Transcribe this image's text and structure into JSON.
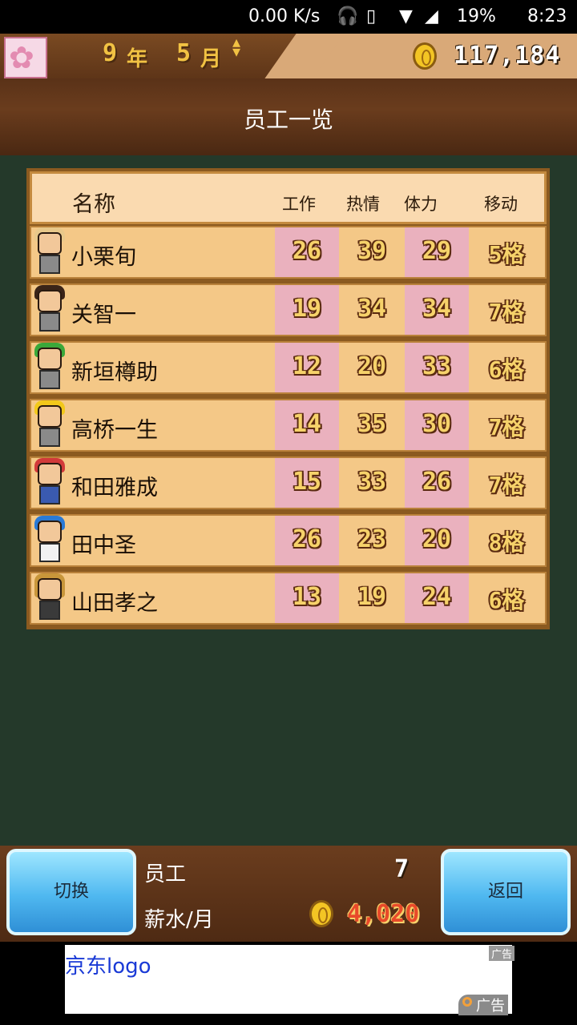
{
  "status_bar": {
    "net_speed": "0.00 K/s",
    "battery": "19%",
    "time": "8:23",
    "icons": [
      "headphones-icon",
      "vibrate-icon",
      "wifi-icon",
      "signal-icon",
      "battery-icon"
    ]
  },
  "top_bar": {
    "year_num": "9",
    "year_label": "年",
    "month_num": "5",
    "month_label": "月",
    "money": "117,184"
  },
  "title": "员工一览",
  "table": {
    "headers": {
      "name": "名称",
      "work": "工作",
      "passion": "热情",
      "stamina": "体力",
      "move": "移动"
    },
    "rows": [
      {
        "name": "小栗旬",
        "work": "26",
        "passion": "39",
        "stamina": "29",
        "move": "5格"
      },
      {
        "name": "关智一",
        "work": "19",
        "passion": "34",
        "stamina": "34",
        "move": "7格"
      },
      {
        "name": "新垣樽助",
        "work": "12",
        "passion": "20",
        "stamina": "33",
        "move": "6格"
      },
      {
        "name": "高桥一生",
        "work": "14",
        "passion": "35",
        "stamina": "30",
        "move": "7格"
      },
      {
        "name": "和田雅成",
        "work": "15",
        "passion": "33",
        "stamina": "26",
        "move": "7格"
      },
      {
        "name": "田中圣",
        "work": "26",
        "passion": "23",
        "stamina": "20",
        "move": "8格"
      },
      {
        "name": "山田孝之",
        "work": "13",
        "passion": "19",
        "stamina": "24",
        "move": "6格"
      }
    ]
  },
  "bottom": {
    "switch_label": "切换",
    "back_label": "返回",
    "staff_label": "员工",
    "staff_count": "7",
    "salary_label": "薪水/月",
    "salary_value": "4,020"
  },
  "ad": {
    "text": "京东logo",
    "tag_small": "广告",
    "tag_large": "广告"
  },
  "colors": {
    "panel_brown": "#6a3c1d",
    "table_row": "#f4c887",
    "pink_col": "#eab1be",
    "button_blue": "#4fb8f0",
    "game_green": "#24392a"
  }
}
